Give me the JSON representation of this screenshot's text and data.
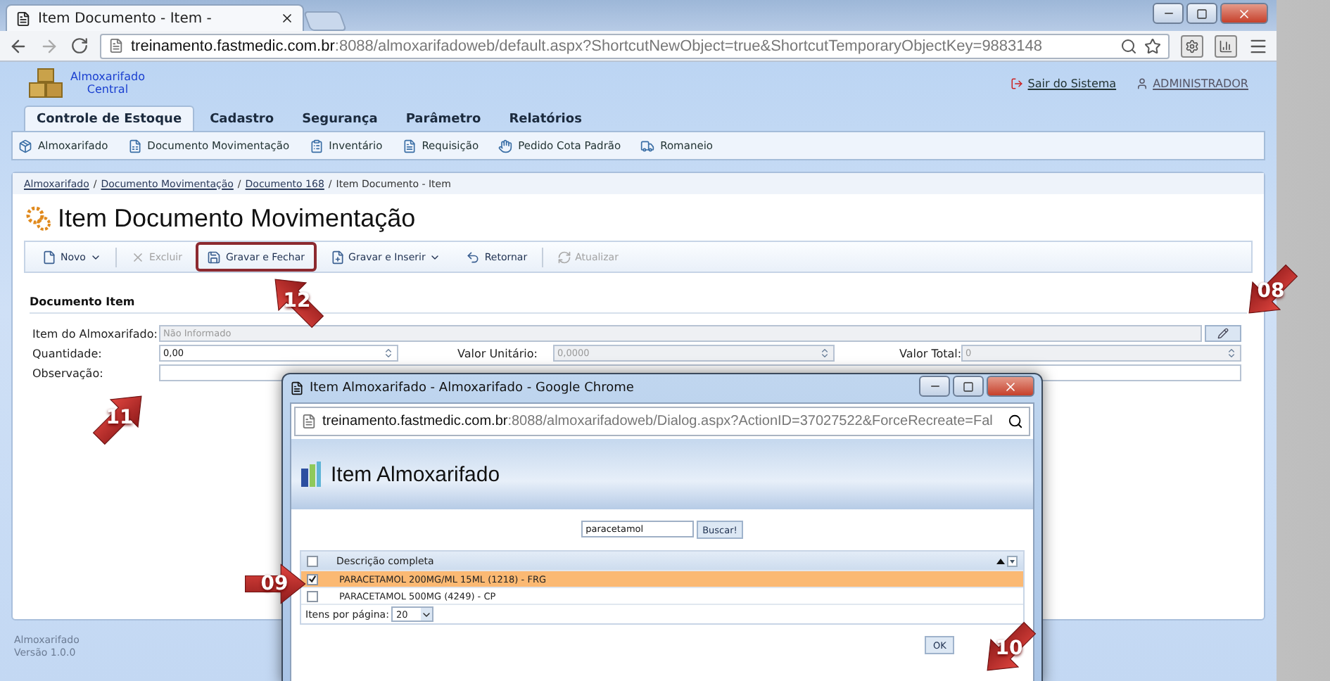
{
  "browser": {
    "tab_title": "Item Documento - Item -",
    "url_host": "treinamento.fastmedic.com.br",
    "url_rest": ":8088/almoxarifadoweb/default.aspx?ShortcutNewObject=true&ShortcutTemporaryObjectKey=9883148"
  },
  "app": {
    "logo_line_1": "Almoxarifado",
    "logo_line_2": "Central",
    "logout": "Sair do Sistema",
    "user": "ADMINISTRADOR"
  },
  "menu": [
    {
      "label": "Controle de Estoque",
      "selected": true
    },
    {
      "label": "Cadastro",
      "selected": false
    },
    {
      "label": "Segurança",
      "selected": false
    },
    {
      "label": "Parâmetro",
      "selected": false
    },
    {
      "label": "Relatórios",
      "selected": false
    }
  ],
  "submenu": [
    "Almoxarifado",
    "Documento Movimentação",
    "Inventário",
    "Requisição",
    "Pedido Cota Padrão",
    "Romaneio"
  ],
  "breadcrumb": [
    {
      "label": "Almoxarifado",
      "separator": "/"
    },
    {
      "label": "Documento Movimentação",
      "separator": "/"
    },
    {
      "label": "Documento 168",
      "separator": "/"
    },
    {
      "label": "Item Documento - Item"
    }
  ],
  "page_title": "Item Documento Movimentação",
  "toolbar": [
    {
      "label": "Novo",
      "disabled": false,
      "dropdown": true,
      "highlighted": false
    },
    {
      "label": "Excluir",
      "disabled": true,
      "dropdown": false,
      "highlighted": false
    },
    {
      "label": "Gravar e Fechar",
      "disabled": false,
      "dropdown": false,
      "highlighted": true
    },
    {
      "label": "Gravar e Inserir",
      "disabled": false,
      "dropdown": true,
      "highlighted": false
    },
    {
      "label": "Retornar",
      "disabled": false,
      "dropdown": false,
      "highlighted": false
    },
    {
      "label": "Atualizar",
      "disabled": true,
      "dropdown": false,
      "highlighted": false
    }
  ],
  "section_title": "Documento Item",
  "form": {
    "item_label": "Item do Almoxarifado:",
    "item_value": "Não Informado",
    "quantity_label": "Quantidade:",
    "quantity_value": "0,00",
    "unit_label": "Valor Unitário:",
    "unit_value": "0,0000",
    "total_label": "Valor Total:",
    "total_value": "0",
    "notes_label": "Observação:"
  },
  "footer": [
    "Almoxarifado",
    "Versão 1.0.0"
  ],
  "dialog": {
    "window_title": "Item Almoxarifado - Almoxarifado - Google Chrome",
    "url_host": "treinamento.fastmedic.com.br",
    "url_rest": ":8088/almoxarifadoweb/Dialog.aspx?ActionID=37027522&ForceRecreate=Fal",
    "heading": "Item Almoxarifado",
    "search_value": "paracetamol",
    "search_button": "Buscar!",
    "all_checked": false,
    "column": "Descrição completa",
    "rows": [
      {
        "text": "PARACETAMOL 200MG/ML 15ML (1218) - FRG",
        "selected": true
      },
      {
        "text": "PARACETAMOL 500MG (4249) - CP",
        "selected": false
      }
    ],
    "page_size_label": "Itens por página:",
    "page_size": "20",
    "ok": "OK"
  },
  "callouts": [
    {
      "number": "12",
      "kind": "up-left"
    },
    {
      "number": "08",
      "kind": "down-left"
    },
    {
      "number": "11",
      "kind": "up-right"
    },
    {
      "number": "09",
      "kind": "right"
    },
    {
      "number": "10",
      "kind": "down-left"
    }
  ]
}
